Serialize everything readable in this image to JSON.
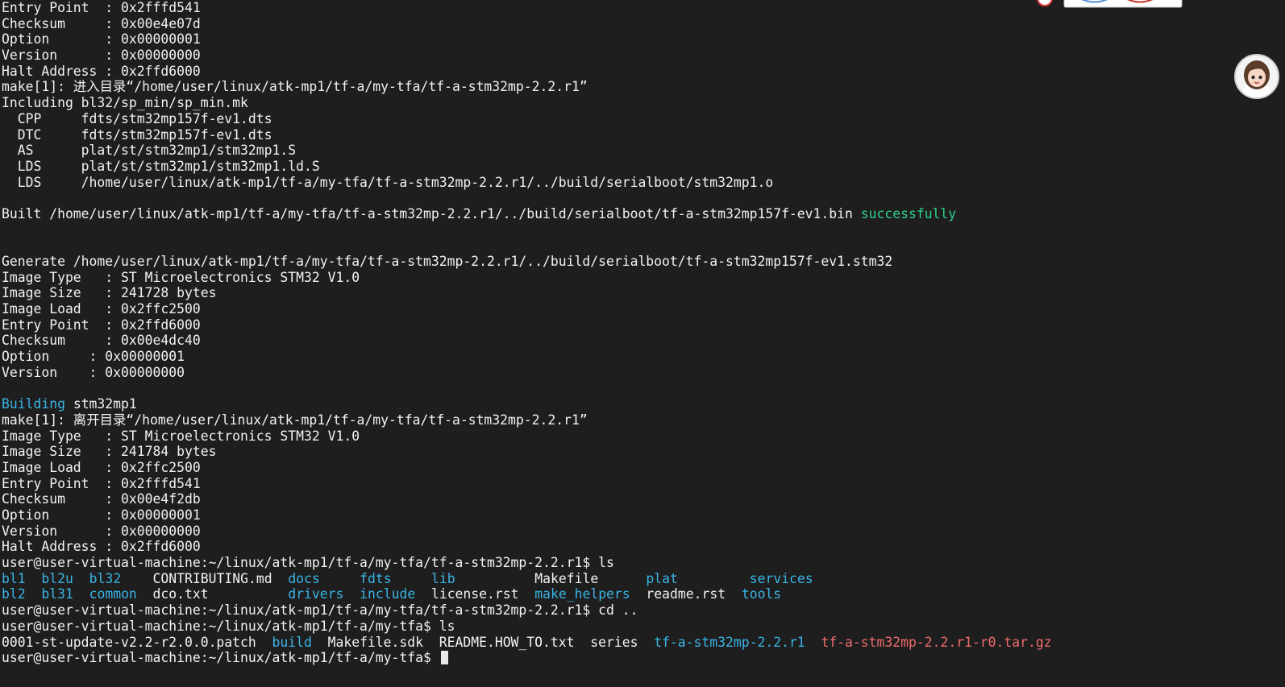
{
  "terminal": {
    "lines": [
      [
        {
          "t": "Entry Point  : 0x2fffd541"
        }
      ],
      [
        {
          "t": "Checksum     : 0x00e4e07d"
        }
      ],
      [
        {
          "t": "Option       : 0x00000001"
        }
      ],
      [
        {
          "t": "Version      : 0x00000000"
        }
      ],
      [
        {
          "t": "Halt Address : 0x2ffd6000"
        }
      ],
      [
        {
          "t": "make[1]: 进入目录“/home/user/linux/atk-mp1/tf-a/my-tfa/tf-a-stm32mp-2.2.r1”"
        }
      ],
      [
        {
          "t": "Including bl32/sp_min/sp_min.mk"
        }
      ],
      [
        {
          "t": "  CPP     fdts/stm32mp157f-ev1.dts"
        }
      ],
      [
        {
          "t": "  DTC     fdts/stm32mp157f-ev1.dts"
        }
      ],
      [
        {
          "t": "  AS      plat/st/stm32mp1/stm32mp1.S"
        }
      ],
      [
        {
          "t": "  LDS     plat/st/stm32mp1/stm32mp1.ld.S"
        }
      ],
      [
        {
          "t": "  LDS     /home/user/linux/atk-mp1/tf-a/my-tfa/tf-a-stm32mp-2.2.r1/../build/serialboot/stm32mp1.o"
        }
      ],
      [
        {
          "t": ""
        }
      ],
      [
        {
          "t": "Built /home/user/linux/atk-mp1/tf-a/my-tfa/tf-a-stm32mp-2.2.r1/../build/serialboot/tf-a-stm32mp157f-ev1.bin "
        },
        {
          "t": "successfully",
          "c": "green"
        }
      ],
      [
        {
          "t": ""
        }
      ],
      [
        {
          "t": ""
        }
      ],
      [
        {
          "t": "Generate /home/user/linux/atk-mp1/tf-a/my-tfa/tf-a-stm32mp-2.2.r1/../build/serialboot/tf-a-stm32mp157f-ev1.stm32"
        }
      ],
      [
        {
          "t": "Image Type   : ST Microelectronics STM32 V1.0"
        }
      ],
      [
        {
          "t": "Image Size   : 241728 bytes"
        }
      ],
      [
        {
          "t": "Image Load   : 0x2ffc2500"
        }
      ],
      [
        {
          "t": "Entry Point  : 0x2ffd6000"
        }
      ],
      [
        {
          "t": "Checksum     : 0x00e4dc40"
        }
      ],
      [
        {
          "t": "Option     : 0x00000001"
        }
      ],
      [
        {
          "t": "Version    : 0x00000000"
        }
      ],
      [
        {
          "t": ""
        }
      ],
      [
        {
          "t": "Building",
          "c": "cyan"
        },
        {
          "t": " stm32mp1"
        }
      ],
      [
        {
          "t": "make[1]: 离开目录“/home/user/linux/atk-mp1/tf-a/my-tfa/tf-a-stm32mp-2.2.r1”"
        }
      ],
      [
        {
          "t": "Image Type   : ST Microelectronics STM32 V1.0"
        }
      ],
      [
        {
          "t": "Image Size   : 241784 bytes"
        }
      ],
      [
        {
          "t": "Image Load   : 0x2ffc2500"
        }
      ],
      [
        {
          "t": "Entry Point  : 0x2fffd541"
        }
      ],
      [
        {
          "t": "Checksum     : 0x00e4f2db"
        }
      ],
      [
        {
          "t": "Option       : 0x00000001"
        }
      ],
      [
        {
          "t": "Version      : 0x00000000"
        }
      ],
      [
        {
          "t": "Halt Address : 0x2ffd6000"
        }
      ],
      [
        {
          "t": "user@user-virtual-machine:~/linux/atk-mp1/tf-a/my-tfa/tf-a-stm32mp-2.2.r1$ ls"
        }
      ],
      [
        {
          "t": "bl1",
          "c": "cyan"
        },
        {
          "t": "  "
        },
        {
          "t": "bl2u",
          "c": "cyan"
        },
        {
          "t": "  "
        },
        {
          "t": "bl32",
          "c": "cyan"
        },
        {
          "t": "    CONTRIBUTING.md  "
        },
        {
          "t": "docs",
          "c": "cyan"
        },
        {
          "t": "     "
        },
        {
          "t": "fdts",
          "c": "cyan"
        },
        {
          "t": "     "
        },
        {
          "t": "lib",
          "c": "cyan"
        },
        {
          "t": "          Makefile      "
        },
        {
          "t": "plat",
          "c": "cyan"
        },
        {
          "t": "         "
        },
        {
          "t": "services",
          "c": "cyan"
        }
      ],
      [
        {
          "t": "bl2",
          "c": "cyan"
        },
        {
          "t": "  "
        },
        {
          "t": "bl31",
          "c": "cyan"
        },
        {
          "t": "  "
        },
        {
          "t": "common",
          "c": "cyan"
        },
        {
          "t": "  dco.txt          "
        },
        {
          "t": "drivers",
          "c": "cyan"
        },
        {
          "t": "  "
        },
        {
          "t": "include",
          "c": "cyan"
        },
        {
          "t": "  license.rst  "
        },
        {
          "t": "make_helpers",
          "c": "cyan"
        },
        {
          "t": "  readme.rst  "
        },
        {
          "t": "tools",
          "c": "cyan"
        }
      ],
      [
        {
          "t": "user@user-virtual-machine:~/linux/atk-mp1/tf-a/my-tfa/tf-a-stm32mp-2.2.r1$ cd .."
        }
      ],
      [
        {
          "t": "user@user-virtual-machine:~/linux/atk-mp1/tf-a/my-tfa$ ls"
        }
      ],
      [
        {
          "t": "0001-st-update-v2.2-r2.0.0.patch  "
        },
        {
          "t": "build",
          "c": "cyan"
        },
        {
          "t": "  Makefile.sdk  README.HOW_TO.txt  series  "
        },
        {
          "t": "tf-a-stm32mp-2.2.r1",
          "c": "cyan"
        },
        {
          "t": "  "
        },
        {
          "t": "tf-a-stm32mp-2.2.r1-r0.tar.gz",
          "c": "red"
        }
      ],
      [
        {
          "t": "user@user-virtual-machine:~/linux/atk-mp1/tf-a/my-tfa$ "
        }
      ]
    ]
  },
  "colors": {
    "background": "#1e1e1e",
    "text": "#f2f2f2",
    "success": "#2fd28a",
    "directory": "#3ab5e6",
    "archive": "#ef6b6b"
  },
  "icons": {
    "avatar": "cartoon-avatar-icon",
    "top_badge": "sticker-badge-icon"
  }
}
